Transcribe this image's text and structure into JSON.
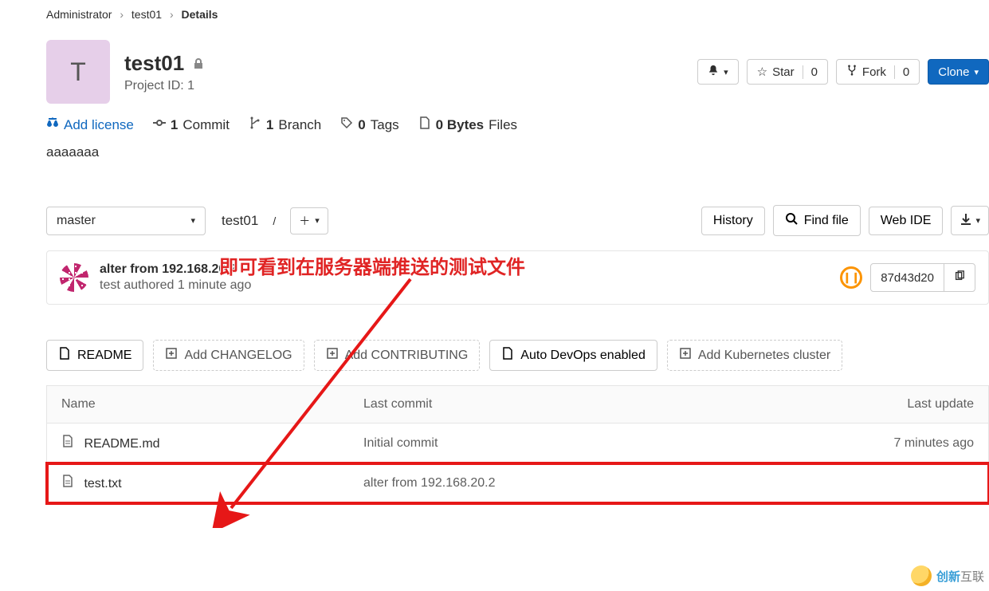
{
  "breadcrumb": {
    "items": [
      "Administrator",
      "test01",
      "Details"
    ]
  },
  "project": {
    "initial": "T",
    "name": "test01",
    "id_label": "Project ID: 1"
  },
  "header_actions": {
    "star_label": "Star",
    "star_count": "0",
    "fork_label": "Fork",
    "fork_count": "0",
    "clone_label": "Clone"
  },
  "stats": {
    "add_license": "Add license",
    "commits_count": "1",
    "commits_label": " Commit",
    "branches_count": "1",
    "branches_label": " Branch",
    "tags_count": "0",
    "tags_label": " Tags",
    "files_count": "0 Bytes",
    "files_label": " Files"
  },
  "description": "aaaaaaa",
  "toolbar": {
    "branch": "master",
    "path_root": "test01",
    "path_sep": "/",
    "history": "History",
    "find_file": "Find file",
    "web_ide": "Web IDE"
  },
  "last_commit": {
    "message": "alter from 192.168.20.2",
    "author_line": "test authored 1 minute ago",
    "sha": "87d43d20"
  },
  "action_buttons": {
    "readme": "README",
    "changelog": "Add CHANGELOG",
    "contributing": "Add CONTRIBUTING",
    "devops": "Auto DevOps enabled",
    "kubernetes": "Add Kubernetes cluster"
  },
  "table": {
    "headers": {
      "name": "Name",
      "last_commit": "Last commit",
      "last_update": "Last update"
    },
    "rows": [
      {
        "name": "README.md",
        "commit": "Initial commit",
        "update": "7 minutes ago"
      },
      {
        "name": "test.txt",
        "commit": "alter from 192.168.20.2",
        "update": ""
      }
    ]
  },
  "annotation": "即可看到在服务器端推送的测试文件",
  "watermark": {
    "brand": "创新",
    "brand2": "互联"
  }
}
